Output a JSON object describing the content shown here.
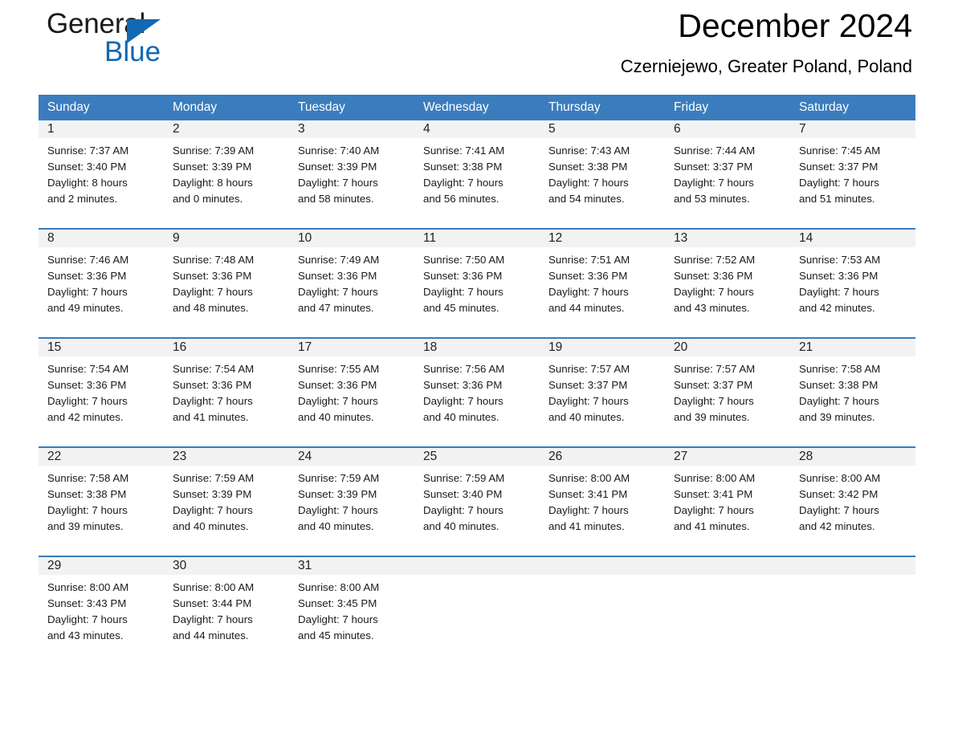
{
  "logo": {
    "word1": "General",
    "word2": "Blue",
    "triangle_color": "#1268b3"
  },
  "header": {
    "title": "December 2024",
    "location": "Czerniejewo, Greater Poland, Poland"
  },
  "theme": {
    "header_blue": "#3a7cbd",
    "date_band": "#f2f2f2",
    "text": "#1a1a1a"
  },
  "daynames": [
    "Sunday",
    "Monday",
    "Tuesday",
    "Wednesday",
    "Thursday",
    "Friday",
    "Saturday"
  ],
  "weeks": [
    [
      {
        "date": "1",
        "sunrise": "Sunrise: 7:37 AM",
        "sunset": "Sunset: 3:40 PM",
        "daylight1": "Daylight: 8 hours",
        "daylight2": "and 2 minutes."
      },
      {
        "date": "2",
        "sunrise": "Sunrise: 7:39 AM",
        "sunset": "Sunset: 3:39 PM",
        "daylight1": "Daylight: 8 hours",
        "daylight2": "and 0 minutes."
      },
      {
        "date": "3",
        "sunrise": "Sunrise: 7:40 AM",
        "sunset": "Sunset: 3:39 PM",
        "daylight1": "Daylight: 7 hours",
        "daylight2": "and 58 minutes."
      },
      {
        "date": "4",
        "sunrise": "Sunrise: 7:41 AM",
        "sunset": "Sunset: 3:38 PM",
        "daylight1": "Daylight: 7 hours",
        "daylight2": "and 56 minutes."
      },
      {
        "date": "5",
        "sunrise": "Sunrise: 7:43 AM",
        "sunset": "Sunset: 3:38 PM",
        "daylight1": "Daylight: 7 hours",
        "daylight2": "and 54 minutes."
      },
      {
        "date": "6",
        "sunrise": "Sunrise: 7:44 AM",
        "sunset": "Sunset: 3:37 PM",
        "daylight1": "Daylight: 7 hours",
        "daylight2": "and 53 minutes."
      },
      {
        "date": "7",
        "sunrise": "Sunrise: 7:45 AM",
        "sunset": "Sunset: 3:37 PM",
        "daylight1": "Daylight: 7 hours",
        "daylight2": "and 51 minutes."
      }
    ],
    [
      {
        "date": "8",
        "sunrise": "Sunrise: 7:46 AM",
        "sunset": "Sunset: 3:36 PM",
        "daylight1": "Daylight: 7 hours",
        "daylight2": "and 49 minutes."
      },
      {
        "date": "9",
        "sunrise": "Sunrise: 7:48 AM",
        "sunset": "Sunset: 3:36 PM",
        "daylight1": "Daylight: 7 hours",
        "daylight2": "and 48 minutes."
      },
      {
        "date": "10",
        "sunrise": "Sunrise: 7:49 AM",
        "sunset": "Sunset: 3:36 PM",
        "daylight1": "Daylight: 7 hours",
        "daylight2": "and 47 minutes."
      },
      {
        "date": "11",
        "sunrise": "Sunrise: 7:50 AM",
        "sunset": "Sunset: 3:36 PM",
        "daylight1": "Daylight: 7 hours",
        "daylight2": "and 45 minutes."
      },
      {
        "date": "12",
        "sunrise": "Sunrise: 7:51 AM",
        "sunset": "Sunset: 3:36 PM",
        "daylight1": "Daylight: 7 hours",
        "daylight2": "and 44 minutes."
      },
      {
        "date": "13",
        "sunrise": "Sunrise: 7:52 AM",
        "sunset": "Sunset: 3:36 PM",
        "daylight1": "Daylight: 7 hours",
        "daylight2": "and 43 minutes."
      },
      {
        "date": "14",
        "sunrise": "Sunrise: 7:53 AM",
        "sunset": "Sunset: 3:36 PM",
        "daylight1": "Daylight: 7 hours",
        "daylight2": "and 42 minutes."
      }
    ],
    [
      {
        "date": "15",
        "sunrise": "Sunrise: 7:54 AM",
        "sunset": "Sunset: 3:36 PM",
        "daylight1": "Daylight: 7 hours",
        "daylight2": "and 42 minutes."
      },
      {
        "date": "16",
        "sunrise": "Sunrise: 7:54 AM",
        "sunset": "Sunset: 3:36 PM",
        "daylight1": "Daylight: 7 hours",
        "daylight2": "and 41 minutes."
      },
      {
        "date": "17",
        "sunrise": "Sunrise: 7:55 AM",
        "sunset": "Sunset: 3:36 PM",
        "daylight1": "Daylight: 7 hours",
        "daylight2": "and 40 minutes."
      },
      {
        "date": "18",
        "sunrise": "Sunrise: 7:56 AM",
        "sunset": "Sunset: 3:36 PM",
        "daylight1": "Daylight: 7 hours",
        "daylight2": "and 40 minutes."
      },
      {
        "date": "19",
        "sunrise": "Sunrise: 7:57 AM",
        "sunset": "Sunset: 3:37 PM",
        "daylight1": "Daylight: 7 hours",
        "daylight2": "and 40 minutes."
      },
      {
        "date": "20",
        "sunrise": "Sunrise: 7:57 AM",
        "sunset": "Sunset: 3:37 PM",
        "daylight1": "Daylight: 7 hours",
        "daylight2": "and 39 minutes."
      },
      {
        "date": "21",
        "sunrise": "Sunrise: 7:58 AM",
        "sunset": "Sunset: 3:38 PM",
        "daylight1": "Daylight: 7 hours",
        "daylight2": "and 39 minutes."
      }
    ],
    [
      {
        "date": "22",
        "sunrise": "Sunrise: 7:58 AM",
        "sunset": "Sunset: 3:38 PM",
        "daylight1": "Daylight: 7 hours",
        "daylight2": "and 39 minutes."
      },
      {
        "date": "23",
        "sunrise": "Sunrise: 7:59 AM",
        "sunset": "Sunset: 3:39 PM",
        "daylight1": "Daylight: 7 hours",
        "daylight2": "and 40 minutes."
      },
      {
        "date": "24",
        "sunrise": "Sunrise: 7:59 AM",
        "sunset": "Sunset: 3:39 PM",
        "daylight1": "Daylight: 7 hours",
        "daylight2": "and 40 minutes."
      },
      {
        "date": "25",
        "sunrise": "Sunrise: 7:59 AM",
        "sunset": "Sunset: 3:40 PM",
        "daylight1": "Daylight: 7 hours",
        "daylight2": "and 40 minutes."
      },
      {
        "date": "26",
        "sunrise": "Sunrise: 8:00 AM",
        "sunset": "Sunset: 3:41 PM",
        "daylight1": "Daylight: 7 hours",
        "daylight2": "and 41 minutes."
      },
      {
        "date": "27",
        "sunrise": "Sunrise: 8:00 AM",
        "sunset": "Sunset: 3:41 PM",
        "daylight1": "Daylight: 7 hours",
        "daylight2": "and 41 minutes."
      },
      {
        "date": "28",
        "sunrise": "Sunrise: 8:00 AM",
        "sunset": "Sunset: 3:42 PM",
        "daylight1": "Daylight: 7 hours",
        "daylight2": "and 42 minutes."
      }
    ],
    [
      {
        "date": "29",
        "sunrise": "Sunrise: 8:00 AM",
        "sunset": "Sunset: 3:43 PM",
        "daylight1": "Daylight: 7 hours",
        "daylight2": "and 43 minutes."
      },
      {
        "date": "30",
        "sunrise": "Sunrise: 8:00 AM",
        "sunset": "Sunset: 3:44 PM",
        "daylight1": "Daylight: 7 hours",
        "daylight2": "and 44 minutes."
      },
      {
        "date": "31",
        "sunrise": "Sunrise: 8:00 AM",
        "sunset": "Sunset: 3:45 PM",
        "daylight1": "Daylight: 7 hours",
        "daylight2": "and 45 minutes."
      },
      {
        "date": "",
        "sunrise": "",
        "sunset": "",
        "daylight1": "",
        "daylight2": ""
      },
      {
        "date": "",
        "sunrise": "",
        "sunset": "",
        "daylight1": "",
        "daylight2": ""
      },
      {
        "date": "",
        "sunrise": "",
        "sunset": "",
        "daylight1": "",
        "daylight2": ""
      },
      {
        "date": "",
        "sunrise": "",
        "sunset": "",
        "daylight1": "",
        "daylight2": ""
      }
    ]
  ]
}
